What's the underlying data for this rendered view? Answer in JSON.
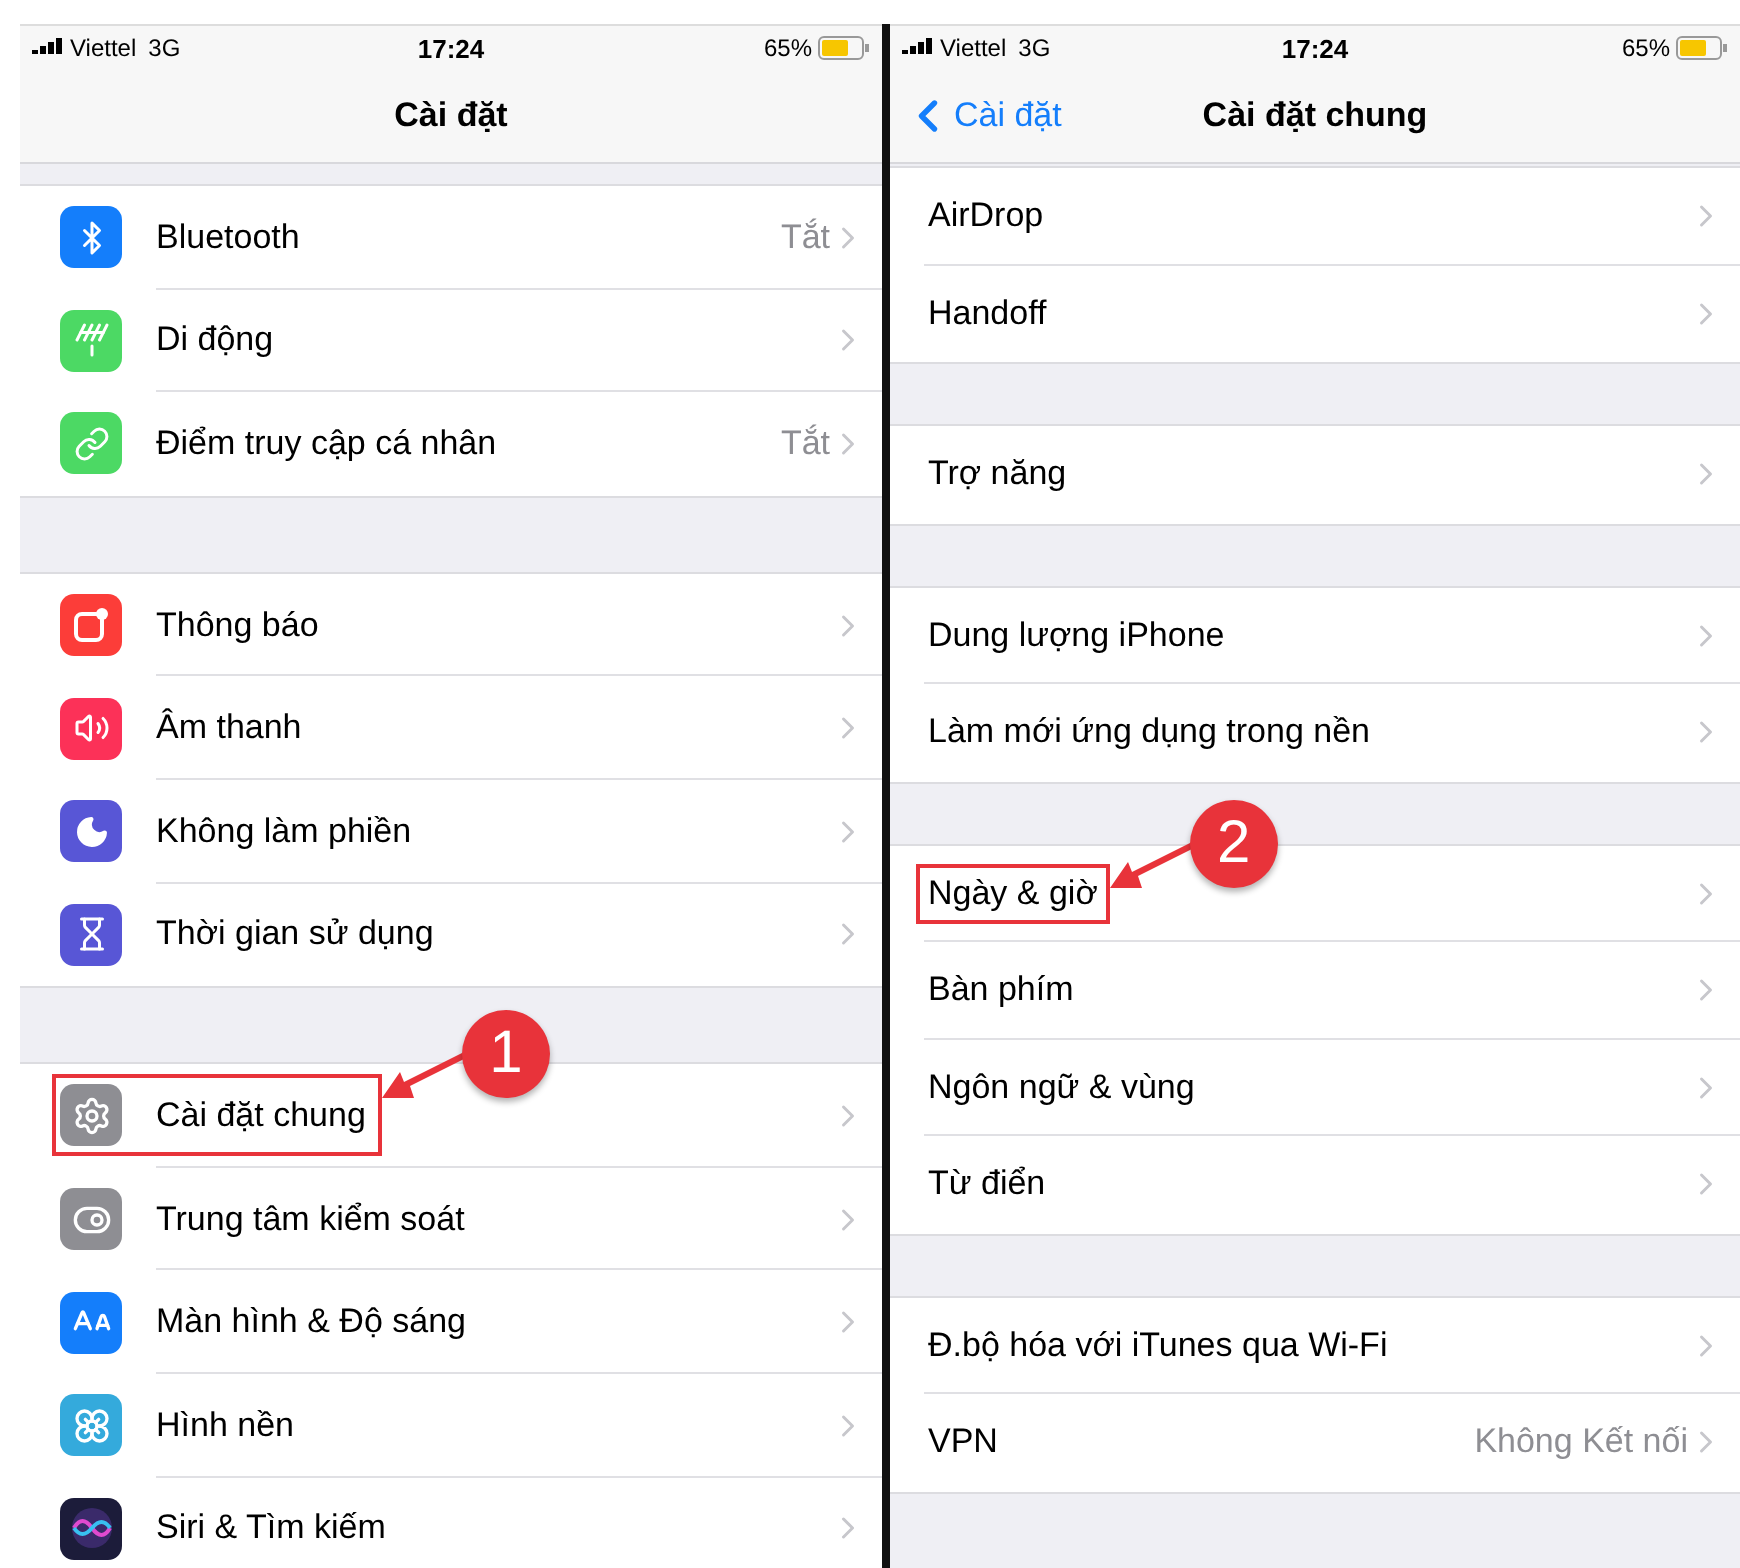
{
  "panels": [
    {
      "status_bar": {
        "carrier": "Viettel",
        "network": "3G",
        "time": "17:24",
        "battery": "65%"
      },
      "nav": {
        "title": "Cài đặt"
      },
      "groups": [
        {
          "items": [
            {
              "label": "Bluetooth",
              "value": "Tắt",
              "color": "#147efb",
              "boxed": false
            },
            {
              "label": "Di động",
              "color": "#4cd964",
              "boxed": false
            },
            {
              "label": "Điểm truy cập cá nhân",
              "value": "Tắt",
              "color": "#4cd964",
              "boxed": false
            }
          ]
        },
        {
          "items": [
            {
              "label": "Thông báo",
              "color": "#fc3d39",
              "boxed": false
            },
            {
              "label": "Âm thanh",
              "color": "#fc3158",
              "boxed": false
            },
            {
              "label": "Không làm phiền",
              "color": "#5856d6",
              "boxed": false
            },
            {
              "label": "Thời gian sử dụng",
              "color": "#5856d6",
              "boxed": false
            }
          ]
        },
        {
          "items": [
            {
              "label": "Cài đặt chung",
              "color": "#8e8e93",
              "boxed": true,
              "callout": "1"
            },
            {
              "label": "Trung tâm kiểm soát",
              "color": "#8e8e93",
              "boxed": false
            },
            {
              "label": "Màn hình & Độ sáng",
              "color": "#147efb",
              "boxed": false
            },
            {
              "label": "Hình nền",
              "color": "#34aadc",
              "boxed": false
            },
            {
              "label": "Siri & Tìm kiếm",
              "color": "#1c1c3a",
              "boxed": false
            }
          ]
        }
      ]
    },
    {
      "status_bar": {
        "carrier": "Viettel",
        "network": "3G",
        "time": "17:24",
        "battery": "65%"
      },
      "nav": {
        "back": "Cài đặt",
        "title": "Cài đặt chung"
      },
      "groups": [
        {
          "items": [
            {
              "label": "AirDrop",
              "boxed": false
            },
            {
              "label": "Handoff",
              "boxed": false
            }
          ]
        },
        {
          "items": [
            {
              "label": "Trợ năng",
              "boxed": false
            }
          ]
        },
        {
          "items": [
            {
              "label": "Dung lượng iPhone",
              "boxed": false
            },
            {
              "label": "Làm mới ứng dụng trong nền",
              "boxed": false
            }
          ]
        },
        {
          "items": [
            {
              "label": "Ngày & giờ",
              "boxed": true,
              "callout": "2"
            },
            {
              "label": "Bàn phím",
              "boxed": false
            },
            {
              "label": "Ngôn ngữ & vùng",
              "boxed": false
            },
            {
              "label": "Từ điển",
              "boxed": false
            }
          ]
        },
        {
          "items": [
            {
              "label": "Đ.bộ hóa với iTunes qua Wi-Fi",
              "boxed": false
            },
            {
              "label": "VPN",
              "value": "Không Kết nối",
              "boxed": false
            }
          ]
        }
      ]
    }
  ]
}
